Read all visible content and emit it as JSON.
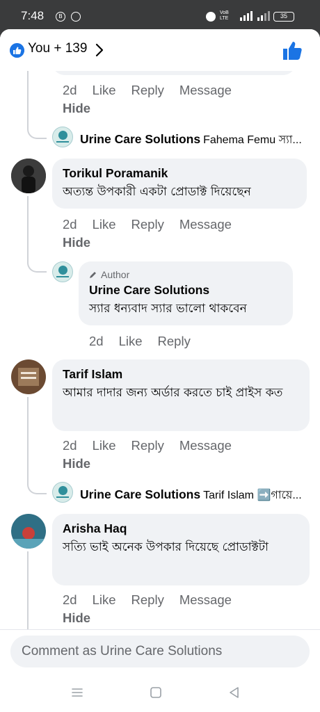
{
  "status": {
    "time": "7:48",
    "net_label_top": "VoB",
    "net_label_bottom": "LTE",
    "battery": "35"
  },
  "header": {
    "reactors": "You + 139"
  },
  "comments": [
    {
      "actions": {
        "time": "2d",
        "like": "Like",
        "reply": "Reply",
        "message": "Message"
      },
      "hide": "Hide"
    },
    {
      "reply_preview": {
        "name": "Urine Care Solutions",
        "text": "Fahema Femu স্যা..."
      }
    },
    {
      "name": "Torikul Poramanik",
      "text": "অত্যন্ত উপকারী একটা প্রোডাক্ট দিয়েছেন",
      "actions": {
        "time": "2d",
        "like": "Like",
        "reply": "Reply",
        "message": "Message"
      },
      "hide": "Hide",
      "reply": {
        "badge": "Author",
        "name": "Urine Care Solutions",
        "text": "স্যার ধন্যবাদ স্যার ভালো থাকবেন",
        "actions": {
          "time": "2d",
          "like": "Like",
          "reply": "Reply"
        }
      }
    },
    {
      "name": "Tarif Islam",
      "text": "আমার দাদার জন্য অর্ডার করতে চাই প্রাইস কত",
      "actions": {
        "time": "2d",
        "like": "Like",
        "reply": "Reply",
        "message": "Message"
      },
      "hide": "Hide",
      "reply_preview": {
        "name": "Urine Care Solutions",
        "text": "Tarif Islam ➡️গায়ে..."
      }
    },
    {
      "name": "Arisha Haq",
      "text": "সত্যি ভাই অনেক উপকার দিয়েছে প্রোডাক্টটা",
      "actions": {
        "time": "2d",
        "like": "Like",
        "reply": "Reply",
        "message": "Message"
      },
      "hide": "Hide"
    }
  ],
  "composer": {
    "placeholder": "Comment as Urine Care Solutions"
  },
  "colors": {
    "accent": "#1b74e4",
    "bubble": "#f0f2f5",
    "meta": "#65676b"
  }
}
